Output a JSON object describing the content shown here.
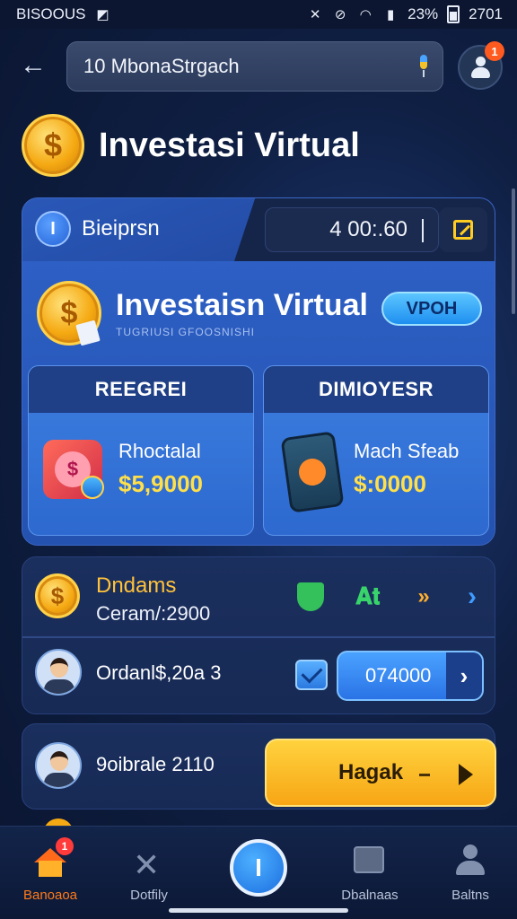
{
  "status_bar": {
    "carrier": "BISOOUS",
    "battery": "23%",
    "time": "2701"
  },
  "search": {
    "value": "10  MbonaStrgach"
  },
  "profile": {
    "badge": "1"
  },
  "page": {
    "title": "Investasi Virtual"
  },
  "main_card": {
    "label": "Bieiprsn",
    "timer": "4 00:.60",
    "panel_title": "Investaisn Virtual",
    "panel_subtitle": "TUGRIUSI GFOOSNISHI",
    "vip_label": "VPOH",
    "left_card": {
      "heading": "REEGREI",
      "label": "Rhoctalal",
      "value": "$5,9000"
    },
    "right_card": {
      "heading": "DIMIOYESR",
      "label": "Mach Sfeab",
      "value": "$:0000"
    }
  },
  "list": {
    "row1": {
      "title": "Dndams",
      "subtitle": "Ceram/:2900"
    },
    "row2": {
      "text": "Ordanl$,20a 3",
      "amount": "074000"
    }
  },
  "action": {
    "text": "9oibrale 2110",
    "button_label": "Hagak"
  },
  "bottom_nav": {
    "home": {
      "label": "Banoaoa",
      "badge": "1"
    },
    "activity": {
      "label": "Dotfily"
    },
    "reports": {
      "label": "Dbalnaas"
    },
    "account": {
      "label": "Baltns"
    }
  },
  "colors": {
    "accent_yellow": "#ffd23e",
    "accent_blue": "#2a73e6",
    "highlight_orange": "#ff7a1a"
  }
}
